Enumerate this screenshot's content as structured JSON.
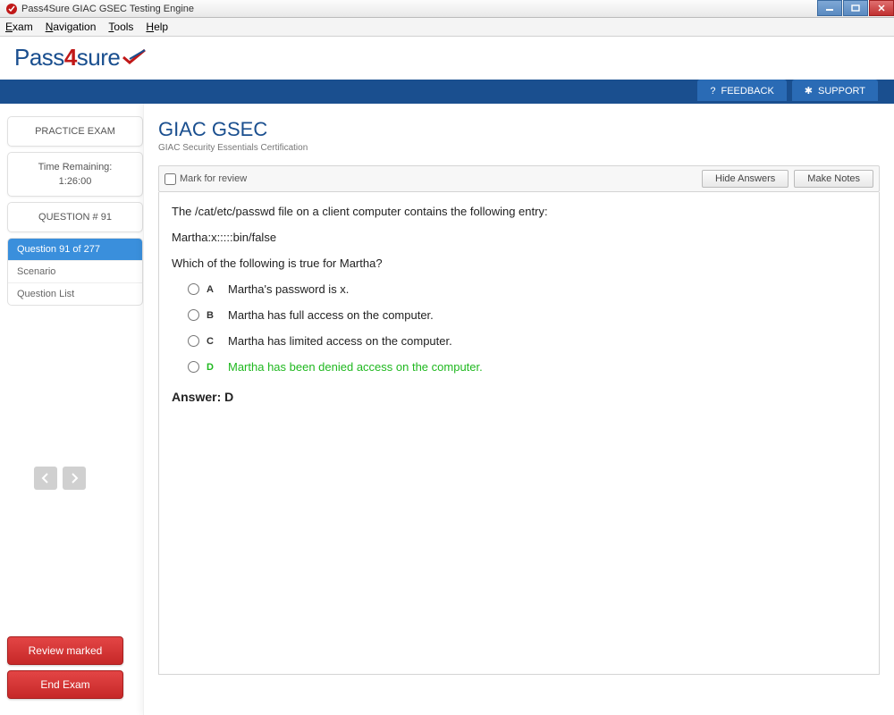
{
  "window": {
    "title": "Pass4Sure GIAC GSEC Testing Engine"
  },
  "menu": {
    "exam": "Exam",
    "navigation": "Navigation",
    "tools": "Tools",
    "help": "Help"
  },
  "logo": {
    "pass": "Pass",
    "four": "4",
    "sure": "sure"
  },
  "strip": {
    "feedback": "FEEDBACK",
    "support": "SUPPORT"
  },
  "sidebar": {
    "practice": "PRACTICE EXAM",
    "time_label": "Time Remaining:",
    "time_value": "1:26:00",
    "question_num": "QUESTION # 91",
    "rows": {
      "current": "Question 91 of 277",
      "scenario": "Scenario",
      "list": "Question List"
    },
    "review_btn": "Review marked",
    "end_btn": "End Exam"
  },
  "main": {
    "title": "GIAC GSEC",
    "subtitle": "GIAC Security Essentials Certification",
    "mark": "Mark for review",
    "hide": "Hide Answers",
    "notes": "Make Notes"
  },
  "question": {
    "line1": "The /cat/etc/passwd file on a client computer contains the following entry:",
    "line2": "Martha:x:::::bin/false",
    "line3": "Which of the following is true for Martha?",
    "opts": {
      "a": {
        "letter": "A",
        "text": "Martha's password is x."
      },
      "b": {
        "letter": "B",
        "text": "Martha has full access on the computer."
      },
      "c": {
        "letter": "C",
        "text": "Martha has limited access on the computer."
      },
      "d": {
        "letter": "D",
        "text": "Martha has been denied access on the computer."
      }
    },
    "answer": "Answer: D"
  }
}
